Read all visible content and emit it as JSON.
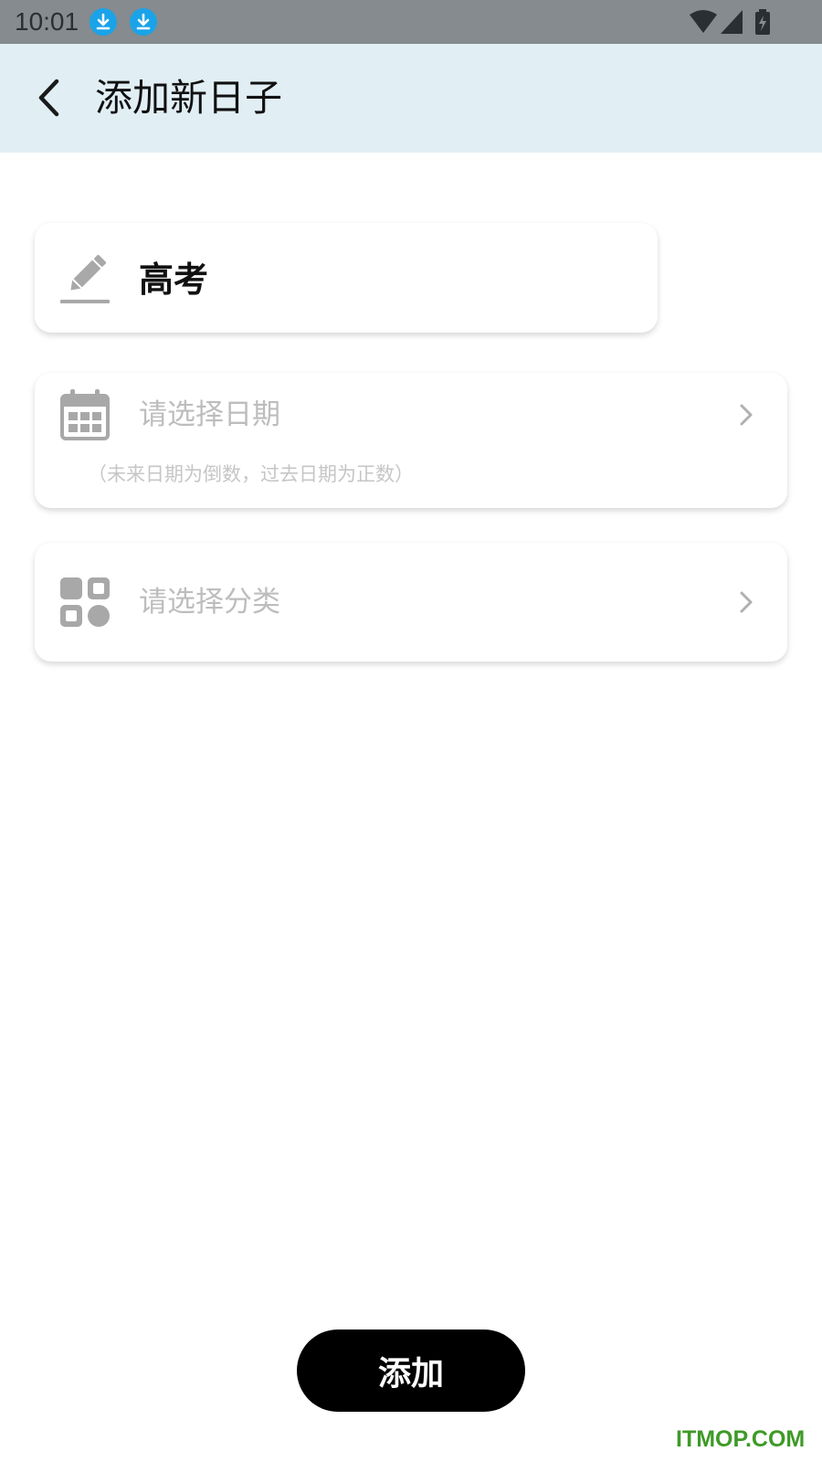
{
  "status_bar": {
    "time": "10:01",
    "icons": [
      "download-icon",
      "download-icon",
      "wifi-icon",
      "signal-icon",
      "battery-charging-icon"
    ]
  },
  "header": {
    "back_icon": "back-arrow-icon",
    "title": "添加新日子"
  },
  "form": {
    "title_field": {
      "icon": "pencil-icon",
      "value": "高考"
    },
    "date_field": {
      "icon": "calendar-icon",
      "placeholder": "请选择日期",
      "hint": "（未来日期为倒数，过去日期为正数）",
      "chevron_icon": "chevron-right-icon"
    },
    "category_field": {
      "icon": "category-grid-icon",
      "placeholder": "请选择分类",
      "chevron_icon": "chevron-right-icon"
    }
  },
  "actions": {
    "add_label": "添加"
  },
  "watermark": "ITMOP.COM",
  "colors": {
    "status_bar": "#858b8e",
    "header_bg": "#e1eff5",
    "download_badge": "#1aa3e8",
    "button_bg": "#000000",
    "placeholder": "#bdbdbd",
    "watermark": "#3e9a27"
  }
}
